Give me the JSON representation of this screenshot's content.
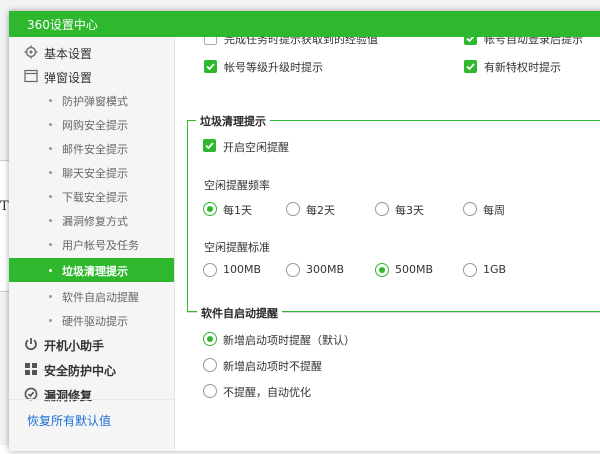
{
  "window": {
    "title": "360设置中心"
  },
  "behind": {
    "fragment": "T"
  },
  "sidebar": {
    "top_items": [
      {
        "label": "基本设置",
        "icon": "gear-icon"
      },
      {
        "label": "弹窗设置",
        "icon": "window-icon"
      }
    ],
    "sub_items": [
      "防护弹窗模式",
      "网购安全提示",
      "邮件安全提示",
      "聊天安全提示",
      "下载安全提示",
      "漏洞修复方式",
      "用户帐号及任务",
      "垃圾清理提示",
      "软件自启动提醒",
      "硬件驱动提示"
    ],
    "active_sub": "垃圾清理提示",
    "bottom_items": [
      {
        "label": "开机小助手",
        "icon": "power-icon"
      },
      {
        "label": "安全防护中心",
        "icon": "shield-icon"
      },
      {
        "label": "漏洞修复",
        "icon": "patch-icon"
      }
    ],
    "reset_link": "恢复所有默认值"
  },
  "account": {
    "row1_left": "完成任务时提示获取到的经验值",
    "row1_right": "帐号自动登录后提示",
    "row2_left": "帐号等级升级时提示",
    "row2_right": "有新特权时提示"
  },
  "junk": {
    "title": "垃圾清理提示",
    "enable_label": "开启空闲提醒",
    "enabled": true,
    "freq_label": "空闲提醒频率",
    "freq_options": [
      "每1天",
      "每2天",
      "每3天",
      "每周"
    ],
    "freq_selected": "每1天",
    "std_label": "空闲提醒标准",
    "std_options": [
      "100MB",
      "300MB",
      "500MB",
      "1GB"
    ],
    "std_selected": "500MB"
  },
  "autostart": {
    "title": "软件自启动提醒",
    "options": [
      "新增启动项时提醒（默认）",
      "新增启动项时不提醒",
      "不提醒，自动优化"
    ],
    "selected": "新增启动项时提醒（默认）"
  },
  "colors": {
    "accent": "#2db82d",
    "link": "#1a6fd8"
  }
}
